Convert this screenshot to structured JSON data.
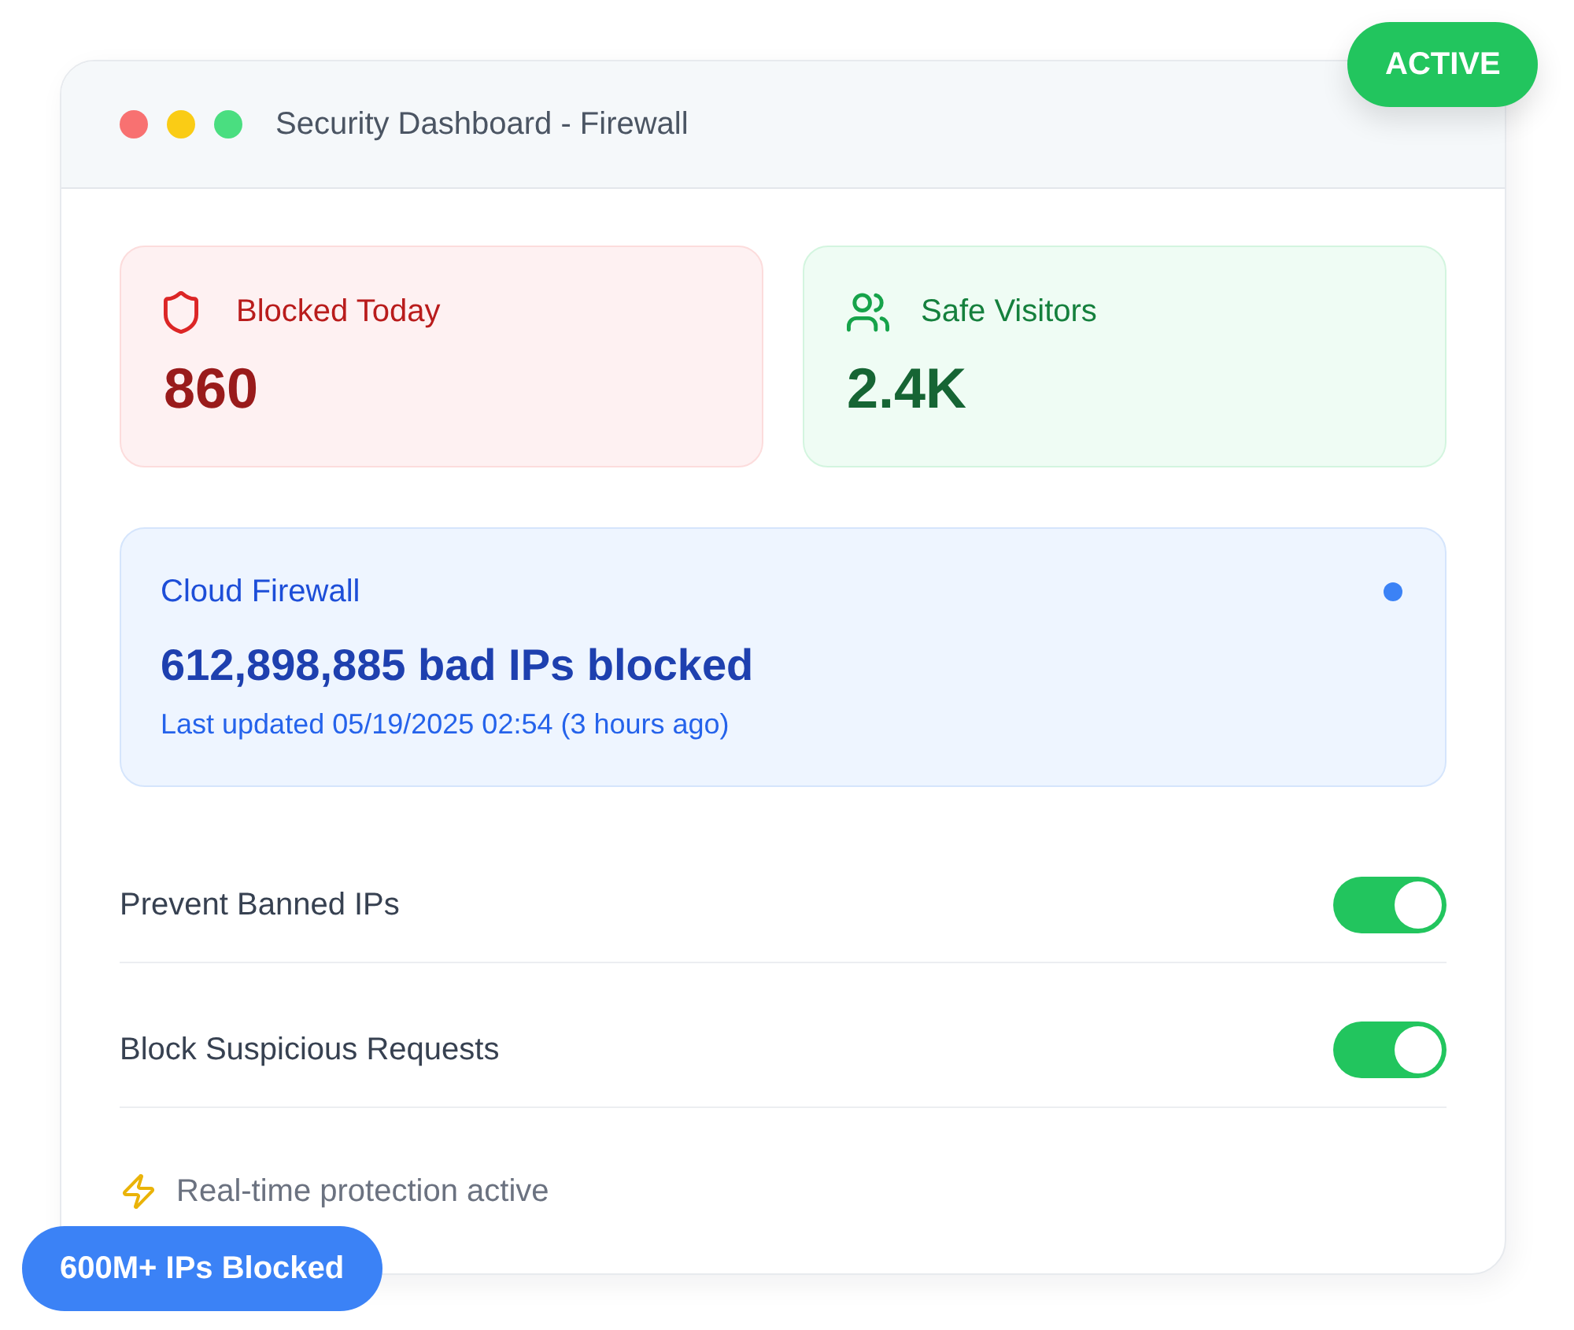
{
  "window": {
    "title": "Security Dashboard - Firewall",
    "controls": [
      {
        "color": "#f87171"
      },
      {
        "color": "#facc15"
      },
      {
        "color": "#4ade80"
      }
    ]
  },
  "status_badge": {
    "label": "ACTIVE"
  },
  "stats": [
    {
      "kind": "blocked",
      "label": "Blocked Today",
      "value": "860"
    },
    {
      "kind": "visitors",
      "label": "Safe Visitors",
      "value": "2.4K"
    }
  ],
  "cloud_firewall": {
    "title": "Cloud Firewall",
    "headline": "612,898,885 bad IPs blocked",
    "updated": "Last updated 05/19/2025 02:54 (3 hours ago)"
  },
  "settings": [
    {
      "label": "Prevent Banned IPs",
      "on": true
    },
    {
      "label": "Block Suspicious Requests",
      "on": true
    }
  ],
  "footer": {
    "text": "Real-time protection active"
  },
  "count_badge": {
    "label": "600M+ IPs Blocked"
  }
}
